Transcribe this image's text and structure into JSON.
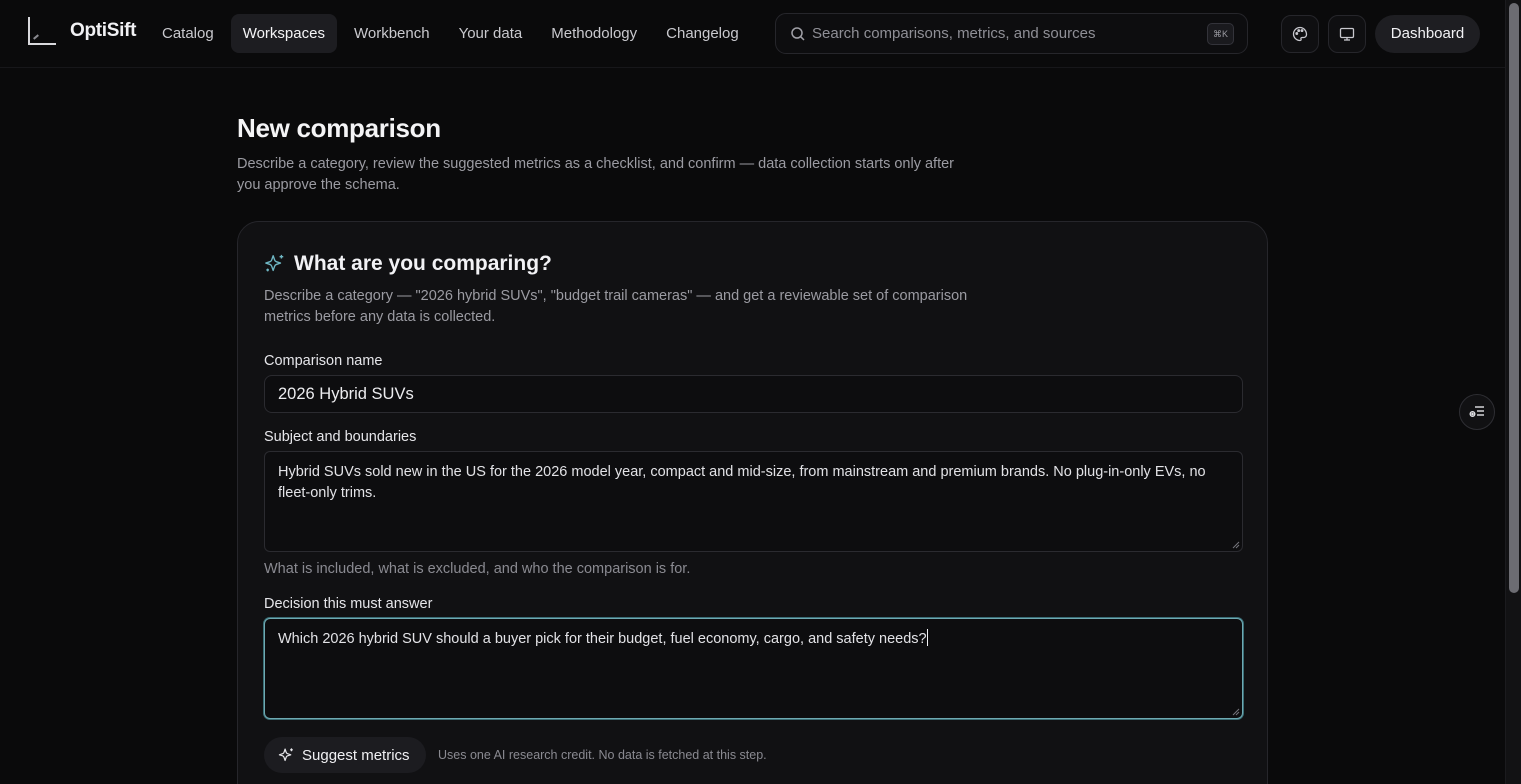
{
  "app": {
    "name": "OptiSift"
  },
  "nav": {
    "items": [
      {
        "label": "Catalog",
        "active": false
      },
      {
        "label": "Workspaces",
        "active": true
      },
      {
        "label": "Workbench",
        "active": false
      },
      {
        "label": "Your data",
        "active": false
      },
      {
        "label": "Methodology",
        "active": false
      },
      {
        "label": "Changelog",
        "active": false
      }
    ]
  },
  "search": {
    "placeholder": "Search comparisons, metrics, and sources",
    "shortcut": "⌘K"
  },
  "header": {
    "theme_icon": "palette-icon",
    "display_icon": "monitor-icon",
    "dashboard_label": "Dashboard"
  },
  "page": {
    "title": "New comparison",
    "description": "Describe a category, review the suggested metrics as a checklist, and confirm — data collection starts only after you approve the schema."
  },
  "card": {
    "icon": "sparkles-icon",
    "title": "What are you comparing?",
    "description": "Describe a category — \"2026 hybrid SUVs\", \"budget trail cameras\" — and get a reviewable set of comparison metrics before any data is collected.",
    "fields": {
      "name": {
        "label": "Comparison name",
        "value": "2026 Hybrid SUVs"
      },
      "subject": {
        "label": "Subject and boundaries",
        "value": "Hybrid SUVs sold new in the US for the 2026 model year, compact and mid-size, from mainstream and premium brands. No plug-in-only EVs, no fleet-only trims.",
        "hint": "What is included, what is excluded, and who the comparison is for."
      },
      "decision": {
        "label": "Decision this must answer",
        "value": "Which 2026 hybrid SUV should a buyer pick for their budget, fuel economy, cargo, and safety needs?"
      }
    },
    "suggest_button": "Suggest metrics",
    "credit_note": "Uses one AI research credit. No data is fetched at this step."
  },
  "colors": {
    "accent": "#6fa9b2",
    "background": "#0a0a0b",
    "card": "#111113"
  }
}
